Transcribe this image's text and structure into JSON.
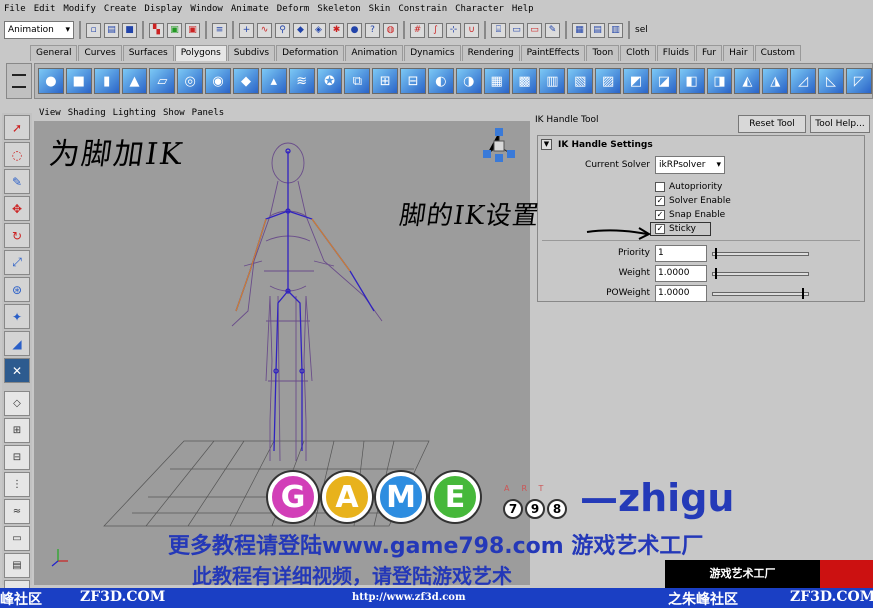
{
  "menubar": [
    "File",
    "Edit",
    "Modify",
    "Create",
    "Display",
    "Window",
    "Animate",
    "Deform",
    "Skeleton",
    "Skin",
    "Constrain",
    "Character",
    "Help"
  ],
  "statusline": {
    "mode": "Animation",
    "sel_label": "sel"
  },
  "shelf_tabs": [
    "General",
    "Curves",
    "Surfaces",
    "Polygons",
    "Subdivs",
    "Deformation",
    "Animation",
    "Dynamics",
    "Rendering",
    "PaintEffects",
    "Toon",
    "Cloth",
    "Fluids",
    "Fur",
    "Hair",
    "Custom"
  ],
  "active_shelf_tab": "Polygons",
  "viewport": {
    "menu": [
      "View",
      "Shading",
      "Lighting",
      "Show",
      "Panels"
    ],
    "handwritten_note": "为脚加IK"
  },
  "tool_settings": {
    "title": "IK Handle Tool",
    "reset_button": "Reset Tool",
    "help_button": "Tool Help...",
    "section": "IK Handle Settings",
    "current_solver_label": "Current Solver",
    "current_solver_value": "ikRPsolver",
    "checkboxes": [
      {
        "label": "Autopriority",
        "checked": false
      },
      {
        "label": "Solver Enable",
        "checked": true
      },
      {
        "label": "Snap Enable",
        "checked": true
      },
      {
        "label": "Sticky",
        "checked": true
      }
    ],
    "priority_label": "Priority",
    "priority_value": "1",
    "priority_fraction": 0.0,
    "weight_label": "Weight",
    "weight_value": "1.0000",
    "weight_fraction": 0.0,
    "poweight_label": "POWeight",
    "poweight_value": "1.0000",
    "poweight_fraction": 1.0,
    "handwritten_note": "脚的IK设置"
  },
  "watermark": {
    "game_letters": [
      "G",
      "A",
      "M",
      "E"
    ],
    "art_letters": "ART",
    "digits": [
      "7",
      "9",
      "8"
    ],
    "author": "—zhigu",
    "promo_line1": "更多教程请登陆www.game798.com 游戏艺术工厂",
    "promo_line2": "此教程有详细视频，请登陆游戏艺术",
    "logo_text": "游戏艺术工厂",
    "bottom_left": "峰社区",
    "bottom_left_domain": "ZF3D.COM",
    "bottom_mid": "http://www.zf3d.com",
    "bottom_right": "之朱峰社区",
    "bottom_right_domain": "ZF3D.COM"
  },
  "colors": {
    "viewport_bg": "#9c9c9c",
    "panel_bg": "#c8c8c8",
    "watermark_blue": "#2438b8",
    "bottombar_blue": "#1a3fc4"
  }
}
